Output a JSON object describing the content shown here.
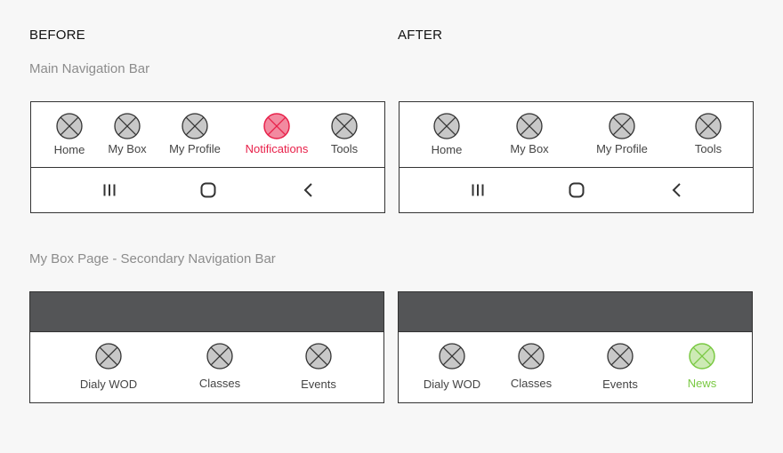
{
  "headings": {
    "before": "BEFORE",
    "after": "AFTER"
  },
  "sections": {
    "main_nav": "Main Navigation Bar",
    "secondary_nav": "My Box Page - Secondary Navigation Bar"
  },
  "colors": {
    "active_red": "#e8214a",
    "active_green": "#7ac943",
    "placeholder_gray": "#c8c8c8"
  },
  "main_nav_before": {
    "items": [
      {
        "label": "Home",
        "icon": "placeholder-icon",
        "state": "default"
      },
      {
        "label": "My Box",
        "icon": "placeholder-icon",
        "state": "default"
      },
      {
        "label": "My Profile",
        "icon": "placeholder-icon",
        "state": "default"
      },
      {
        "label": "Notifications",
        "icon": "placeholder-icon",
        "state": "active-red"
      },
      {
        "label": "Tools",
        "icon": "placeholder-icon",
        "state": "default"
      }
    ]
  },
  "main_nav_after": {
    "items": [
      {
        "label": "Home",
        "icon": "placeholder-icon",
        "state": "default"
      },
      {
        "label": "My Box",
        "icon": "placeholder-icon",
        "state": "default"
      },
      {
        "label": "My Profile",
        "icon": "placeholder-icon",
        "state": "default"
      },
      {
        "label": "Tools",
        "icon": "placeholder-icon",
        "state": "default"
      }
    ]
  },
  "android_bar": {
    "buttons": [
      "recents-icon",
      "home-circle-icon",
      "back-icon"
    ]
  },
  "secondary_before": {
    "items": [
      {
        "label": "Dialy WOD",
        "icon": "placeholder-icon",
        "state": "default"
      },
      {
        "label": "Classes",
        "icon": "placeholder-icon",
        "state": "default"
      },
      {
        "label": "Events",
        "icon": "placeholder-icon",
        "state": "default"
      }
    ]
  },
  "secondary_after": {
    "items": [
      {
        "label": "Dialy WOD",
        "icon": "placeholder-icon",
        "state": "default"
      },
      {
        "label": "Classes",
        "icon": "placeholder-icon",
        "state": "default"
      },
      {
        "label": "Events",
        "icon": "placeholder-icon",
        "state": "default"
      },
      {
        "label": "News",
        "icon": "placeholder-icon",
        "state": "active-green"
      }
    ]
  }
}
